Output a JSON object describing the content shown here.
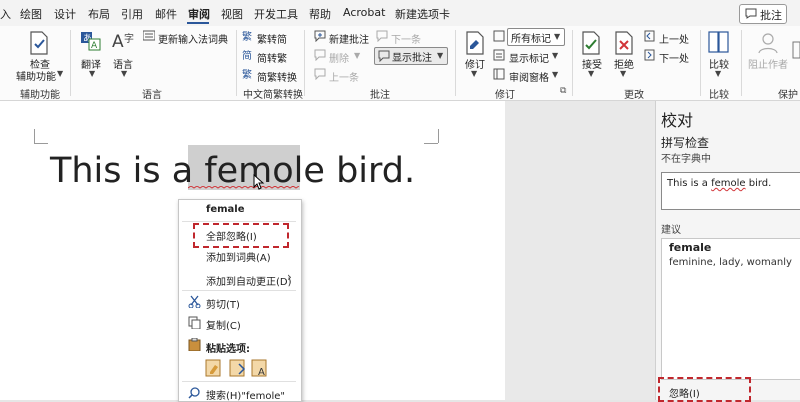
{
  "menu": {
    "tabs": [
      "入",
      "绘图",
      "设计",
      "布局",
      "引用",
      "邮件",
      "审阅",
      "视图",
      "开发工具",
      "帮助",
      "Acrobat",
      "新建选项卡"
    ],
    "active_tab": "审阅",
    "annot_button": "批注"
  },
  "ribbon": {
    "accessibility": {
      "check_label": "检查",
      "feature_label": "辅助功能",
      "group": "辅助功能"
    },
    "language": {
      "translate": "翻译",
      "language": "语言",
      "update_ime": "更新输入法词典",
      "group": "语言"
    },
    "chinese_conv": {
      "to_trad": "繁转简",
      "to_simp": "简转繁",
      "conv": "简繁转换",
      "group": "中文简繁转换"
    },
    "comments": {
      "new": "新建批注",
      "delete": "删除",
      "prev": "上一条",
      "next": "下一条",
      "show": "显示批注",
      "group": "批注"
    },
    "tracking": {
      "track": "修订",
      "markup": "所有标记",
      "show_markup": "显示标记",
      "review_pane": "审阅窗格",
      "group": "修订"
    },
    "changes": {
      "accept": "接受",
      "reject": "拒绝",
      "prev": "上一处",
      "next": "下一处",
      "group": "更改"
    },
    "compare": {
      "compare": "比较",
      "group": "比较"
    },
    "protect": {
      "block": "阻止作者",
      "group": "保护"
    }
  },
  "document": {
    "before": "This is a ",
    "word": "femole",
    "after": " bird."
  },
  "context_menu": {
    "suggestion": "female",
    "ignore_all": "全部忽略(I)",
    "add_dict": "添加到词典(A)",
    "add_autocorrect": "添加到自动更正(D)",
    "cut": "剪切(T)",
    "copy": "复制(C)",
    "paste_options": "粘贴选项:",
    "search": "搜索(H)\"femole\""
  },
  "pane": {
    "title": "校对",
    "subtitle": "拼写检查",
    "status": "不在字典中",
    "context_before": "This is a ",
    "context_word": "femole",
    "context_after": " bird.",
    "suggestions_label": "建议",
    "suggestion_word": "female",
    "synonyms": "feminine, lady, womanly",
    "ignore": "忽略(I)"
  },
  "colors": {
    "accent": "#2b579a",
    "highlight_box": "#c0272d",
    "squiggle": "#d13438"
  }
}
